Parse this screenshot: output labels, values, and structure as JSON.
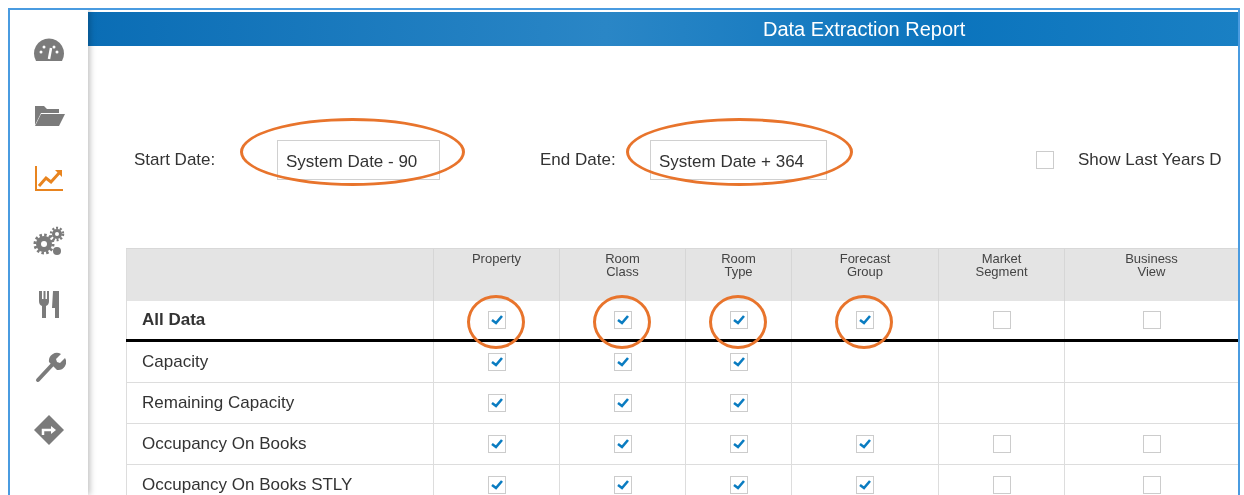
{
  "sidebar": {
    "items": [
      {
        "selected": false
      },
      {
        "selected": false
      },
      {
        "selected": true
      },
      {
        "selected": false
      },
      {
        "selected": false
      },
      {
        "selected": false
      },
      {
        "selected": false
      }
    ]
  },
  "header": {
    "title": "Data Extraction Report"
  },
  "filters": {
    "start": {
      "label": "Start Date:",
      "value": "System Date - 90",
      "highlighted": true
    },
    "end": {
      "label": "End Date:",
      "value": "System Date + 364",
      "highlighted": true
    },
    "last_year": {
      "label": "Show Last Years D",
      "checked": false
    }
  },
  "table": {
    "columns": [
      "Property",
      "Room Class",
      "Room Type",
      "Forecast Group",
      "Market Segment",
      "Business View"
    ],
    "rows": [
      {
        "label": "All Data",
        "bold": true,
        "cells": [
          {
            "kind": "checkbox",
            "checked": true,
            "highlighted": true
          },
          {
            "kind": "checkbox",
            "checked": true,
            "highlighted": true
          },
          {
            "kind": "checkbox",
            "checked": true,
            "highlighted": true
          },
          {
            "kind": "checkbox",
            "checked": true,
            "highlighted": true
          },
          {
            "kind": "checkbox",
            "checked": false,
            "highlighted": false
          },
          {
            "kind": "checkbox",
            "checked": false,
            "highlighted": false
          }
        ]
      },
      {
        "label": "Capacity",
        "bold": false,
        "cells": [
          {
            "kind": "checkbox",
            "checked": true,
            "highlighted": false
          },
          {
            "kind": "checkbox",
            "checked": true,
            "highlighted": false
          },
          {
            "kind": "checkbox",
            "checked": true,
            "highlighted": false
          },
          {
            "kind": "empty"
          },
          {
            "kind": "empty"
          },
          {
            "kind": "empty"
          }
        ]
      },
      {
        "label": "Remaining Capacity",
        "bold": false,
        "cells": [
          {
            "kind": "checkbox",
            "checked": true,
            "highlighted": false
          },
          {
            "kind": "checkbox",
            "checked": true,
            "highlighted": false
          },
          {
            "kind": "checkbox",
            "checked": true,
            "highlighted": false
          },
          {
            "kind": "empty"
          },
          {
            "kind": "empty"
          },
          {
            "kind": "empty"
          }
        ]
      },
      {
        "label": "Occupancy On Books",
        "bold": false,
        "cells": [
          {
            "kind": "checkbox",
            "checked": true,
            "highlighted": false
          },
          {
            "kind": "checkbox",
            "checked": true,
            "highlighted": false
          },
          {
            "kind": "checkbox",
            "checked": true,
            "highlighted": false
          },
          {
            "kind": "checkbox",
            "checked": true,
            "highlighted": false
          },
          {
            "kind": "checkbox",
            "checked": false,
            "highlighted": false
          },
          {
            "kind": "checkbox",
            "checked": false,
            "highlighted": false
          }
        ]
      },
      {
        "label": "Occupancy On Books STLY",
        "bold": false,
        "cells": [
          {
            "kind": "checkbox",
            "checked": true,
            "highlighted": false
          },
          {
            "kind": "checkbox",
            "checked": true,
            "highlighted": false
          },
          {
            "kind": "checkbox",
            "checked": true,
            "highlighted": false
          },
          {
            "kind": "checkbox",
            "checked": true,
            "highlighted": false
          },
          {
            "kind": "checkbox",
            "checked": false,
            "highlighted": false
          },
          {
            "kind": "checkbox",
            "checked": false,
            "highlighted": false
          }
        ]
      }
    ]
  }
}
